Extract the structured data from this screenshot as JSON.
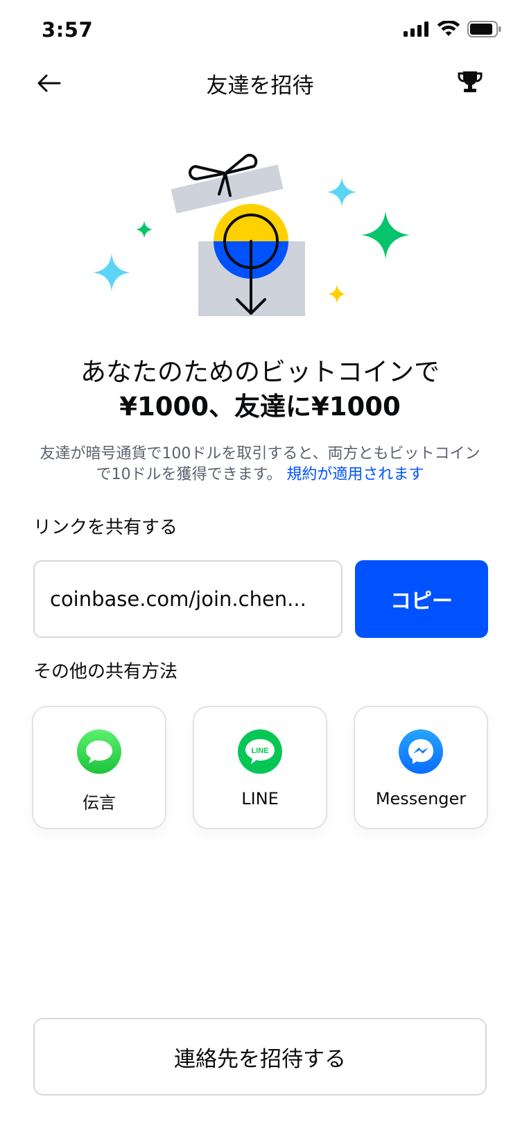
{
  "status_bar": {
    "time": "3:57"
  },
  "nav": {
    "title": "友達を招待"
  },
  "headline": {
    "line1": "あなたのためのビットコインで",
    "line2": "¥1000、友達に¥1000"
  },
  "description": {
    "text": "友達が暗号通貨で100ドルを取引すると、両方ともビットコインで10ドルを獲得できます。",
    "link": "規約が適用されます"
  },
  "share_link": {
    "label": "リンクを共有する",
    "value": "coinbase.com/join.chen...",
    "copy_label": "コピー"
  },
  "other_share": {
    "label": "その他の共有方法",
    "options": [
      {
        "label": "伝言",
        "icon": "messages-icon",
        "color": "#2fd158"
      },
      {
        "label": "LINE",
        "icon": "line-icon",
        "color": "#06c755",
        "icon_text": "LINE"
      },
      {
        "label": "Messenger",
        "icon": "messenger-icon",
        "color": "#0a7cff"
      }
    ]
  },
  "invite_contacts": {
    "label": "連絡先を招待する"
  },
  "colors": {
    "primary": "#0052ff",
    "text_secondary": "#5b616e",
    "border": "#d5d8de"
  }
}
